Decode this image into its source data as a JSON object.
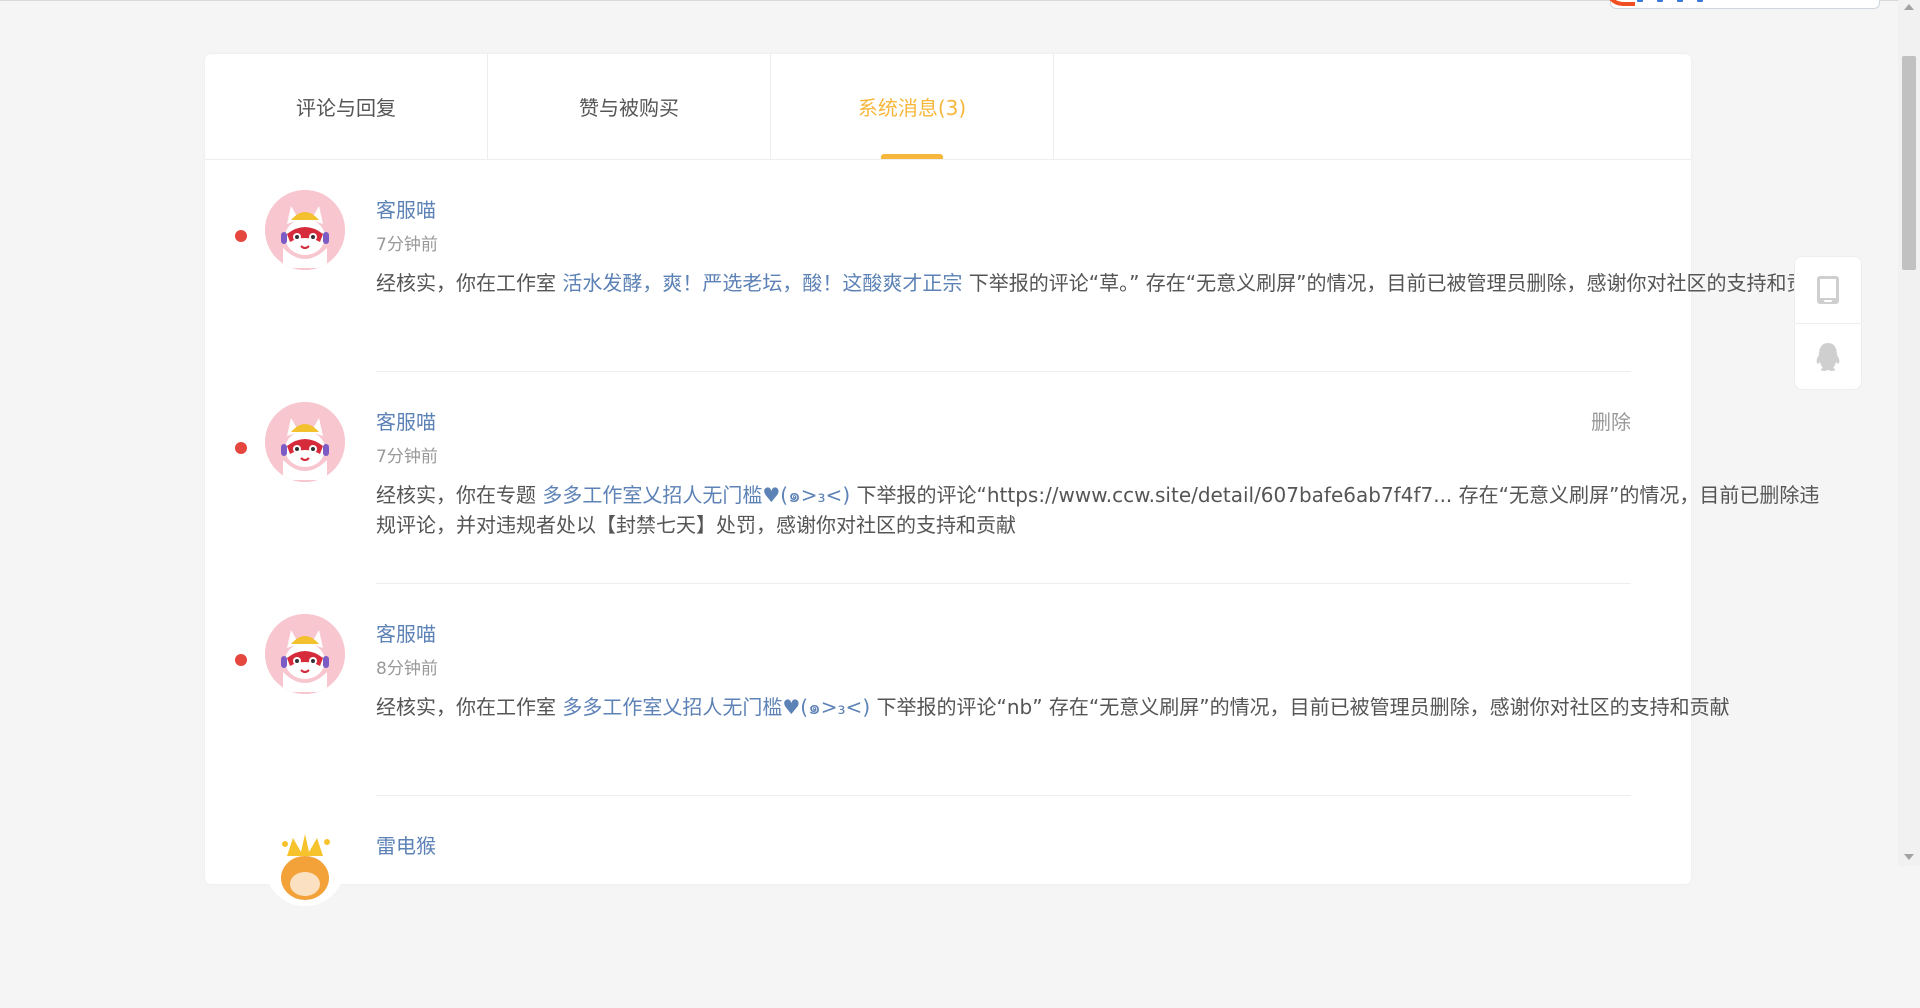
{
  "tabs": [
    {
      "label": "评论与回复"
    },
    {
      "label": "赞与被购买"
    },
    {
      "label": "系统消息(3)"
    }
  ],
  "messages": [
    {
      "sender": "客服喵",
      "time": "7分钟前",
      "body_prefix": "经核实，你在工作室 ",
      "link": "活水发酵，爽！严选老坛，酸！这酸爽才正宗",
      "body_suffix": " 下举报的评论“草。” 存在“无意义刷屏”的情况，目前已被管理员删除，感谢你对社区的支持和贡献",
      "unread": true
    },
    {
      "sender": "客服喵",
      "time": "7分钟前",
      "delete_label": "删除",
      "body_prefix": "经核实，你在专题 ",
      "link": "多多工作室乂招人无门槛♥(๑>₃<)",
      "body_suffix": " 下举报的评论“https://www.ccw.site/detail/607bafe6ab7f4f7... 存在“无意义刷屏”的情况，目前已删除违规评论，并对违规者处以【封禁七天】处罚，感谢你对社区的支持和贡献",
      "unread": true
    },
    {
      "sender": "客服喵",
      "time": "8分钟前",
      "body_prefix": "经核实，你在工作室 ",
      "link": "多多工作室乂招人无门槛♥(๑>₃<)",
      "body_suffix": " 下举报的评论“nb” 存在“无意义刷屏”的情况，目前已被管理员删除，感谢你对社区的支持和贡献",
      "unread": true
    },
    {
      "sender": "雷电猴"
    }
  ],
  "colors": {
    "accent": "#f6b73c",
    "link": "#5d82b6",
    "unread_dot": "#e5473f"
  },
  "icons": {
    "tool_1": "tablet-icon",
    "tool_2": "penguin-icon"
  }
}
